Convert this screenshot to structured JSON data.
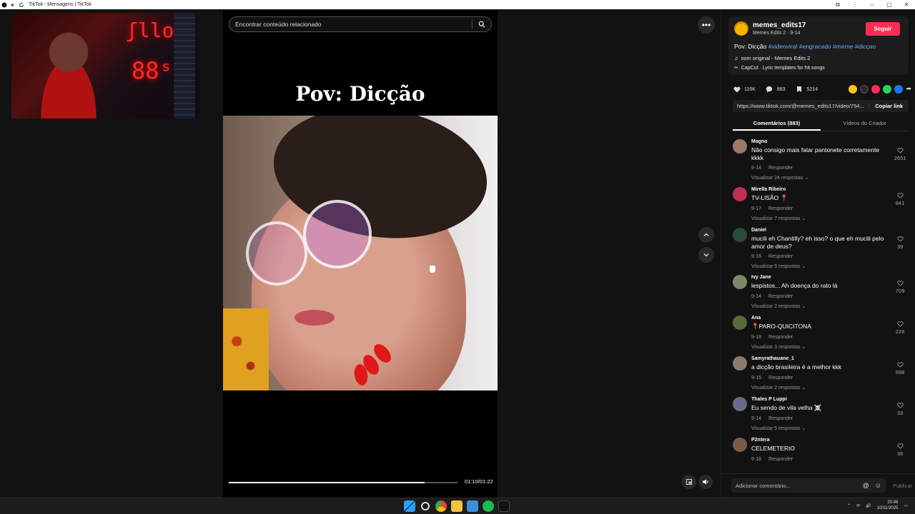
{
  "browser": {
    "title": "TikTok - Mensagens | TikTok"
  },
  "video": {
    "search_placeholder": "Encontrar conteúdo relacionado",
    "overlay_title": "Pov: Dicção",
    "time": "01:10/01:22",
    "progress_fraction": 0.857
  },
  "author": {
    "username": "memes_edits17",
    "subtitle": "Memes Edits 2 · 9-14",
    "follow_label": "Seguir",
    "caption_text": "Pov: Dicção",
    "hashtags": [
      "#videoviral",
      "#engracado",
      "#meme",
      "#dicçao"
    ],
    "music": "som original - Memes Edits 2",
    "capcut": "CapCut · Lyric templates for hit songs"
  },
  "stats": {
    "likes": "116K",
    "comments": "883",
    "saves": "5214"
  },
  "share": {
    "url": "https://www.tiktok.com/@memes_edits17/video/754...",
    "copy_label": "Copiar link",
    "colors": [
      "#f5c518",
      "#2a2a2a",
      "#fe2c55",
      "#25d366",
      "#1877f2"
    ]
  },
  "tabs": [
    {
      "label": "Comentários (883)"
    },
    {
      "label": "Vídeos do Criador"
    }
  ],
  "comments": [
    {
      "name": "Magno",
      "text": "Não consigo mais falar pantonete corretamente kkkk",
      "date": "9-14",
      "reply": "Responder",
      "replies": "Visualizar 24 respostas",
      "likes": "2651",
      "avatar_color": "#9a7a6a"
    },
    {
      "name": "Mirella Ribeiro",
      "text": "TV-LISÃO 📍",
      "date": "9-17",
      "reply": "Responder",
      "replies": "Visualizar 7 respostas",
      "likes": "841",
      "avatar_color": "#c03050"
    },
    {
      "name": "Daniel",
      "text": "mucili eh Chantilly? eh isso? o que eh mucili pelo amor de deus?",
      "date": "9-16",
      "reply": "Responder",
      "replies": "Visualizar 5 respostas",
      "likes": "39",
      "avatar_color": "#2a4a3a"
    },
    {
      "name": "Ivy Jane",
      "text": "lespistos... Ah doença do rato lá",
      "date": "9-14",
      "reply": "Responder",
      "replies": "Visualizar 2 respostas",
      "likes": "709",
      "avatar_color": "#7a8a6a"
    },
    {
      "name": "Ana",
      "text": "📍PARO-QUICITONA",
      "date": "9-18",
      "reply": "Responder",
      "replies": "Visualizar 3 respostas",
      "likes": "228",
      "avatar_color": "#5a6a3a"
    },
    {
      "name": "Samyrathauane_1",
      "text": "a dicção brasileira é a melhor kkk",
      "date": "9-15",
      "reply": "Responder",
      "replies": "Visualizar 2 respostas",
      "likes": "998",
      "avatar_color": "#8a7a6a"
    },
    {
      "name": "Thales P Luppi",
      "text": "Eu sendo de vila velha ☠️",
      "date": "9-14",
      "reply": "Responder",
      "replies": "Visualizar 5 respostas",
      "likes": "33",
      "avatar_color": "#6a6a8a"
    },
    {
      "name": "P2ntera",
      "text": "CELEMETERIO",
      "date": "9-18",
      "reply": "Responder",
      "replies": "",
      "likes": "36",
      "avatar_color": "#7a5a4a"
    }
  ],
  "add_comment": {
    "placeholder": "Adicionar comentário...",
    "publish_label": "Publicar"
  },
  "taskbar": {
    "time": "20:48",
    "date": "10/11/2025"
  }
}
